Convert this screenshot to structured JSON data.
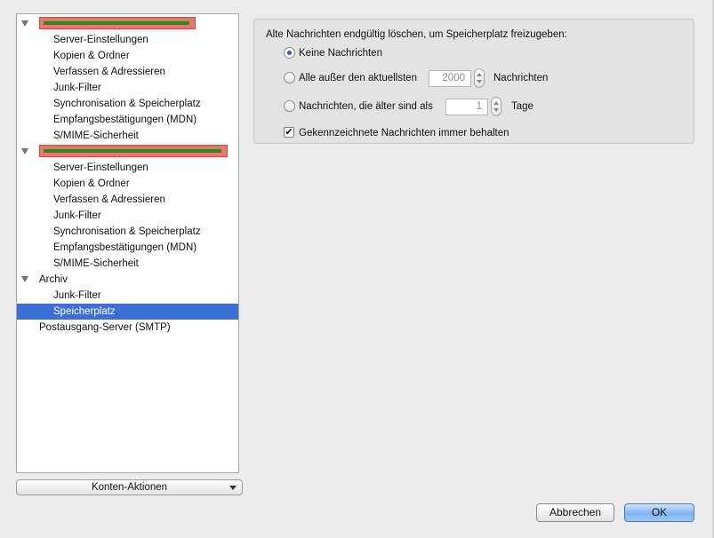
{
  "tree": {
    "rows": [
      {
        "kind": "account",
        "label": ""
      },
      {
        "kind": "item",
        "label": "Server-Einstellungen"
      },
      {
        "kind": "item",
        "label": "Kopien & Ordner"
      },
      {
        "kind": "item",
        "label": "Verfassen & Adressieren"
      },
      {
        "kind": "item",
        "label": "Junk-Filter"
      },
      {
        "kind": "item",
        "label": "Synchronisation & Speicherplatz"
      },
      {
        "kind": "item",
        "label": "Empfangsbestätigungen (MDN)"
      },
      {
        "kind": "item",
        "label": "S/MIME-Sicherheit"
      },
      {
        "kind": "account",
        "label": ""
      },
      {
        "kind": "item",
        "label": "Server-Einstellungen"
      },
      {
        "kind": "item",
        "label": "Kopien & Ordner"
      },
      {
        "kind": "item",
        "label": "Verfassen & Adressieren"
      },
      {
        "kind": "item",
        "label": "Junk-Filter"
      },
      {
        "kind": "item",
        "label": "Synchronisation & Speicherplatz"
      },
      {
        "kind": "item",
        "label": "Empfangsbestätigungen (MDN)"
      },
      {
        "kind": "item",
        "label": "S/MIME-Sicherheit"
      },
      {
        "kind": "folder",
        "label": "Archiv"
      },
      {
        "kind": "item",
        "label": "Junk-Filter"
      },
      {
        "kind": "item",
        "label": "Speicherplatz",
        "selected": true
      },
      {
        "kind": "root",
        "label": "Postausgang-Server (SMTP)"
      }
    ]
  },
  "account_actions": {
    "label": "Konten-Aktionen"
  },
  "storage": {
    "heading": "Alte Nachrichten endgültig löschen, um Speicherplatz freizugeben:",
    "opt_none": "Keine Nachrichten",
    "opt_keep_prefix": "Alle außer den aktuellsten",
    "keep_value": "2000",
    "keep_unit": "Nachrichten",
    "opt_older_prefix": "Nachrichten, die älter sind als",
    "older_value": "1",
    "older_unit": "Tage",
    "keep_flagged": "Gekennzeichnete Nachrichten immer behalten",
    "selected_option": "none",
    "keep_flagged_checked": true
  },
  "buttons": {
    "cancel": "Abbrechen",
    "ok": "OK"
  },
  "colors": {
    "selection": "#3a6fd3",
    "redaction": "#e9776d",
    "redaction_bar": "#2a8a1e"
  }
}
